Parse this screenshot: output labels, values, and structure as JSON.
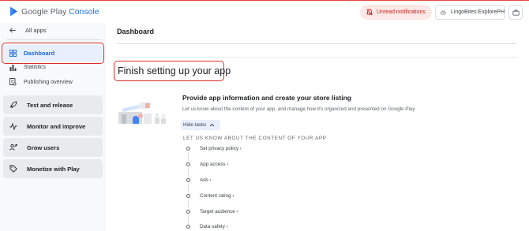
{
  "header": {
    "brand_prefix": "Google Play",
    "brand_suffix": "Console",
    "notifications_label": "Unread notifications",
    "account_label": "LingoBites:ExplorePH",
    "logo_icon": "play-console-logo-icon",
    "bell_icon": "bell-off-icon",
    "account_icon": "developer-account-icon",
    "briefcase_icon": "briefcase-icon"
  },
  "sidebar": {
    "back_label": "All apps",
    "dashboard_label": "Dashboard",
    "sub_items": [
      {
        "label": "Statistics",
        "icon": "bar-chart-icon"
      },
      {
        "label": "Publishing overview",
        "icon": "publishing-overview-icon"
      }
    ],
    "groups": [
      {
        "label": "Test and release",
        "icon": "rocket-icon"
      },
      {
        "label": "Monitor and improve",
        "icon": "pulse-icon"
      },
      {
        "label": "Grow users",
        "icon": "grow-users-icon"
      },
      {
        "label": "Monetize with Play",
        "icon": "tag-icon"
      }
    ]
  },
  "main": {
    "page_title": "Dashboard",
    "finish_title": "Finish setting up your app",
    "section_heading": "Provide app information and create your store listing",
    "section_desc": "Let us know about the content of your app, and manage how it's organized and presented on Google Play",
    "hide_tasks_label": "Hide tasks",
    "tasks_heading": "LET US KNOW ABOUT THE CONTENT OF YOUR APP",
    "tasks": [
      {
        "label": "Set privacy policy ›"
      },
      {
        "label": "App access ›"
      },
      {
        "label": "Ads ›"
      },
      {
        "label": "Content rating ›"
      },
      {
        "label": "Target audience ›"
      },
      {
        "label": "Data safety ›"
      }
    ]
  },
  "colors": {
    "accent_blue": "#1a73e8",
    "highlight_red": "#d93025",
    "active_bg": "#e8f0fe"
  }
}
